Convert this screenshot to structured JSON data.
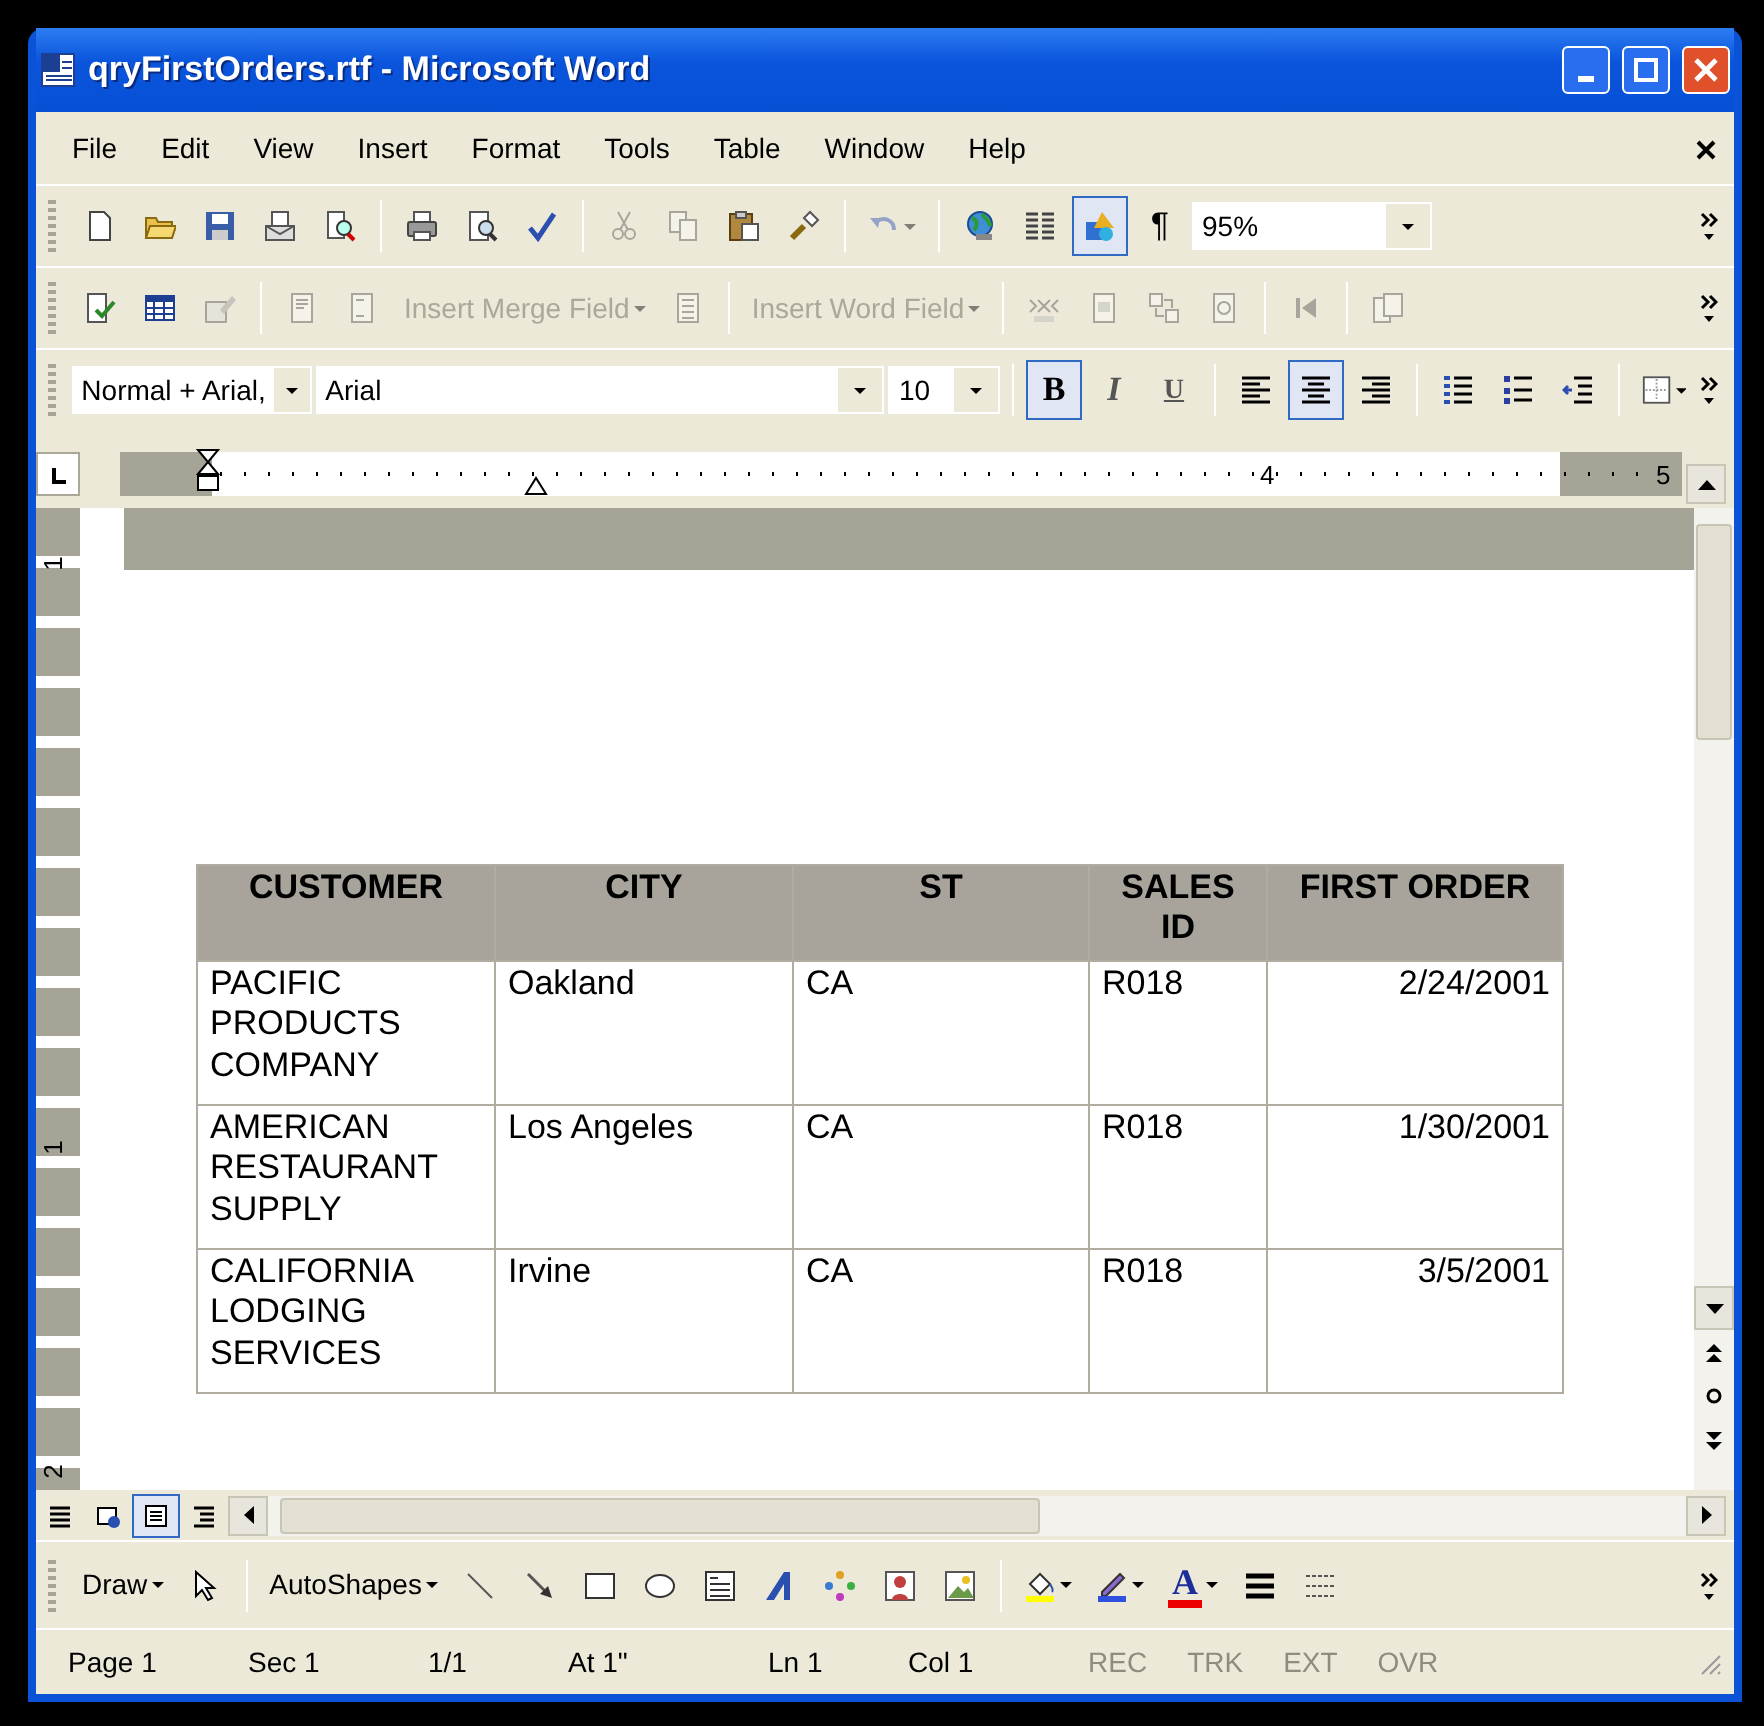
{
  "window": {
    "title": "qryFirstOrders.rtf - Microsoft Word"
  },
  "menu": [
    {
      "label": "File"
    },
    {
      "label": "Edit"
    },
    {
      "label": "View"
    },
    {
      "label": "Insert"
    },
    {
      "label": "Format"
    },
    {
      "label": "Tools"
    },
    {
      "label": "Table"
    },
    {
      "label": "Window"
    },
    {
      "label": "Help"
    }
  ],
  "standard_toolbar": [
    {
      "kind": "button",
      "pressed": false,
      "disabled": false
    },
    {
      "kind": "button",
      "pressed": false,
      "disabled": false
    },
    {
      "kind": "button",
      "pressed": false,
      "disabled": false
    },
    {
      "kind": "button",
      "pressed": false,
      "disabled": false
    },
    {
      "kind": "button",
      "pressed": false,
      "disabled": false
    },
    {
      "kind": "separator"
    },
    {
      "kind": "button",
      "pressed": false,
      "disabled": false
    },
    {
      "kind": "button",
      "pressed": false,
      "disabled": false
    },
    {
      "kind": "button",
      "pressed": false,
      "disabled": false
    },
    {
      "kind": "separator"
    },
    {
      "kind": "button",
      "pressed": false,
      "disabled": true
    },
    {
      "kind": "button",
      "pressed": false,
      "disabled": true
    },
    {
      "kind": "button",
      "pressed": false,
      "disabled": false
    },
    {
      "kind": "button",
      "pressed": false,
      "disabled": false
    },
    {
      "kind": "separator"
    },
    {
      "kind": "button",
      "pressed": false,
      "disabled": true
    },
    {
      "kind": "separator"
    },
    {
      "kind": "button",
      "pressed": false,
      "disabled": false
    },
    {
      "kind": "button",
      "pressed": false,
      "disabled": false
    },
    {
      "kind": "button",
      "pressed": true,
      "disabled": false
    },
    {
      "kind": "text_button",
      "label": "¶",
      "pressed": false,
      "disabled": false
    },
    {
      "kind": "combo",
      "value": "95%"
    }
  ],
  "mail_merge_toolbar": [
    {
      "kind": "button",
      "pressed": false,
      "disabled": false
    },
    {
      "kind": "button",
      "pressed": false,
      "disabled": false
    },
    {
      "kind": "button",
      "pressed": false,
      "disabled": true
    },
    {
      "kind": "separator"
    },
    {
      "kind": "button",
      "pressed": false,
      "disabled": true
    },
    {
      "kind": "button",
      "pressed": false,
      "disabled": true
    },
    {
      "kind": "text_button",
      "label": "Insert Merge Field",
      "menu": true,
      "pressed": false,
      "disabled": true
    },
    {
      "kind": "button",
      "pressed": false,
      "disabled": true
    },
    {
      "kind": "separator"
    },
    {
      "kind": "text_button",
      "label": "Insert Word Field",
      "menu": true,
      "pressed": false,
      "disabled": true
    },
    {
      "kind": "separator"
    },
    {
      "kind": "button",
      "pressed": false,
      "disabled": true
    },
    {
      "kind": "button",
      "pressed": false,
      "disabled": true
    },
    {
      "kind": "button",
      "pressed": false,
      "disabled": true
    },
    {
      "kind": "button",
      "pressed": false,
      "disabled": true
    },
    {
      "kind": "separator"
    },
    {
      "kind": "button",
      "pressed": false,
      "disabled": true
    },
    {
      "kind": "separator"
    },
    {
      "kind": "button",
      "pressed": false,
      "disabled": true
    }
  ],
  "formatting_toolbar": [
    {
      "kind": "combo",
      "value": "Normal + Arial,"
    },
    {
      "kind": "combo",
      "value": "Arial"
    },
    {
      "kind": "combo",
      "value": "10"
    },
    {
      "kind": "separator"
    },
    {
      "kind": "text_button",
      "label": "B",
      "pressed": true,
      "disabled": false
    },
    {
      "kind": "text_button",
      "label": "I",
      "pressed": false,
      "disabled": false
    },
    {
      "kind": "text_button",
      "label": "U",
      "pressed": false,
      "disabled": false
    },
    {
      "kind": "separator"
    },
    {
      "kind": "button",
      "pressed": false,
      "disabled": false
    },
    {
      "kind": "button",
      "pressed": true,
      "disabled": false
    },
    {
      "kind": "button",
      "pressed": false,
      "disabled": false
    },
    {
      "kind": "separator"
    },
    {
      "kind": "button",
      "pressed": false,
      "disabled": false
    },
    {
      "kind": "button",
      "pressed": false,
      "disabled": false
    },
    {
      "kind": "button",
      "pressed": false,
      "disabled": false
    },
    {
      "kind": "separator"
    },
    {
      "kind": "button",
      "pressed": false,
      "disabled": false
    }
  ],
  "ruler": {
    "numbers": [
      "4",
      "5"
    ]
  },
  "vertical_ruler": {
    "numbers": [
      "1",
      "1",
      "2"
    ]
  },
  "table": {
    "columns": [
      "CUSTOMER",
      "CITY",
      "ST",
      "SALES ID",
      "FIRST ORDER"
    ],
    "rows": [
      [
        "PACIFIC PRODUCTS COMPANY",
        "Oakland",
        "CA",
        "R018",
        "2/24/2001"
      ],
      [
        "AMERICAN RESTAURANT SUPPLY",
        "Los Angeles",
        "CA",
        "R018",
        "1/30/2001"
      ],
      [
        "CALIFORNIA LODGING SERVICES",
        "Irvine",
        "CA",
        "R018",
        "3/5/2001"
      ]
    ]
  },
  "view_buttons": [
    {
      "selected": false
    },
    {
      "selected": false
    },
    {
      "selected": true
    },
    {
      "selected": false
    }
  ],
  "drawing_toolbar": [
    {
      "kind": "text_button",
      "label": "Draw",
      "menu": true,
      "pressed": false,
      "disabled": false
    },
    {
      "kind": "button",
      "pressed": false,
      "disabled": false
    },
    {
      "kind": "separator"
    },
    {
      "kind": "text_button",
      "label": "AutoShapes",
      "menu": true,
      "pressed": false,
      "disabled": false
    },
    {
      "kind": "button",
      "pressed": false,
      "disabled": false
    },
    {
      "kind": "button",
      "pressed": false,
      "disabled": false
    },
    {
      "kind": "button",
      "pressed": false,
      "disabled": false
    },
    {
      "kind": "button",
      "pressed": false,
      "disabled": false
    },
    {
      "kind": "button",
      "pressed": false,
      "disabled": false
    },
    {
      "kind": "button",
      "pressed": false,
      "disabled": false
    },
    {
      "kind": "button",
      "pressed": false,
      "disabled": false
    },
    {
      "kind": "button",
      "pressed": false,
      "disabled": false
    },
    {
      "kind": "button",
      "pressed": false,
      "disabled": false
    },
    {
      "kind": "separator"
    },
    {
      "kind": "button",
      "pressed": false,
      "disabled": false
    },
    {
      "kind": "button",
      "pressed": false,
      "disabled": false
    },
    {
      "kind": "color_text",
      "label": "A",
      "pressed": false,
      "disabled": false
    },
    {
      "kind": "button",
      "pressed": false,
      "disabled": false
    },
    {
      "kind": "button",
      "pressed": false,
      "disabled": false
    }
  ],
  "status_bar": [
    {
      "label": "Page 1",
      "disabled": false
    },
    {
      "label": "Sec 1",
      "disabled": false
    },
    {
      "label": "1/1",
      "disabled": false
    },
    {
      "label": "At 1\"",
      "disabled": false
    },
    {
      "label": "Ln 1",
      "disabled": false
    },
    {
      "label": "Col 1",
      "disabled": false
    },
    {
      "label": "REC",
      "disabled": true
    },
    {
      "label": "TRK",
      "disabled": true
    },
    {
      "label": "EXT",
      "disabled": true
    },
    {
      "label": "OVR",
      "disabled": true
    }
  ]
}
